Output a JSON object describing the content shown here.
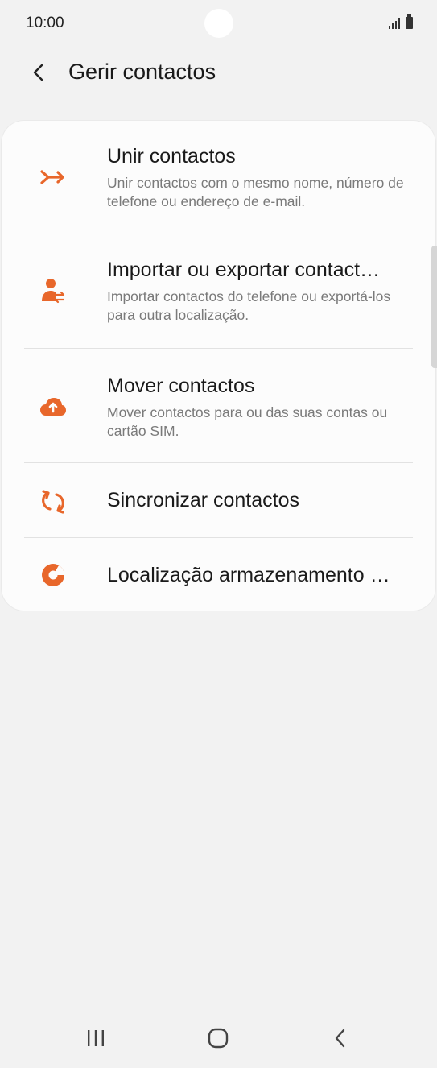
{
  "status_bar": {
    "time": "10:00"
  },
  "header": {
    "title": "Gerir contactos"
  },
  "menu": {
    "items": [
      {
        "title": "Unir contactos",
        "description": "Unir contactos com o mesmo nome, número de telefone ou endereço de e-mail.",
        "icon": "merge-arrow-icon"
      },
      {
        "title": "Importar ou exportar contact…",
        "description": "Importar contactos do telefone ou exportá-los para outra localização.",
        "icon": "person-transfer-icon"
      },
      {
        "title": "Mover contactos",
        "description": "Mover contactos para ou das suas contas ou cartão SIM.",
        "icon": "cloud-upload-icon"
      },
      {
        "title": "Sincronizar contactos",
        "icon": "sync-icon"
      },
      {
        "title": "Localização armazenamento …",
        "icon": "storage-pie-icon"
      }
    ]
  },
  "colors": {
    "accent": "#e8672b",
    "background": "#f2f2f2",
    "card": "#fcfcfc",
    "secondary_text": "#7a7a7a"
  }
}
